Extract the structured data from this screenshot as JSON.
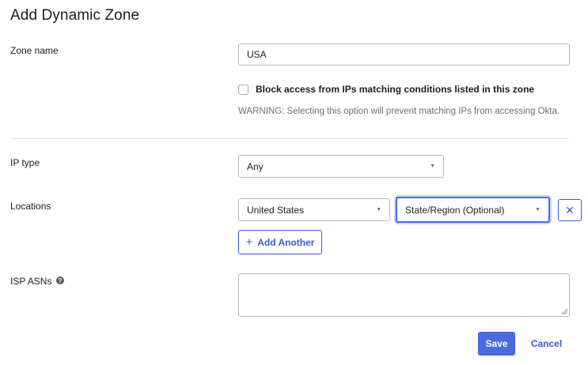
{
  "page": {
    "title": "Add Dynamic Zone"
  },
  "zone_name": {
    "label": "Zone name",
    "value": "USA"
  },
  "block_access": {
    "label": "Block access from IPs matching conditions listed in this zone",
    "checked": false,
    "warning": "WARNING: Selecting this option will prevent matching IPs from accessing Okta."
  },
  "ip_type": {
    "label": "IP type",
    "selected": "Any"
  },
  "locations": {
    "label": "Locations",
    "country": "United States",
    "region": "State/Region (Optional)",
    "remove_label": "✕",
    "add_label": "Add Another",
    "add_icon": "+"
  },
  "isp_asns": {
    "label": "ISP ASNs",
    "help_icon": "?",
    "value": ""
  },
  "actions": {
    "save": "Save",
    "cancel": "Cancel"
  },
  "colors": {
    "accent": "#4a6be0",
    "link": "#3a5bc7",
    "focus_ring": "#c9d4f7"
  }
}
